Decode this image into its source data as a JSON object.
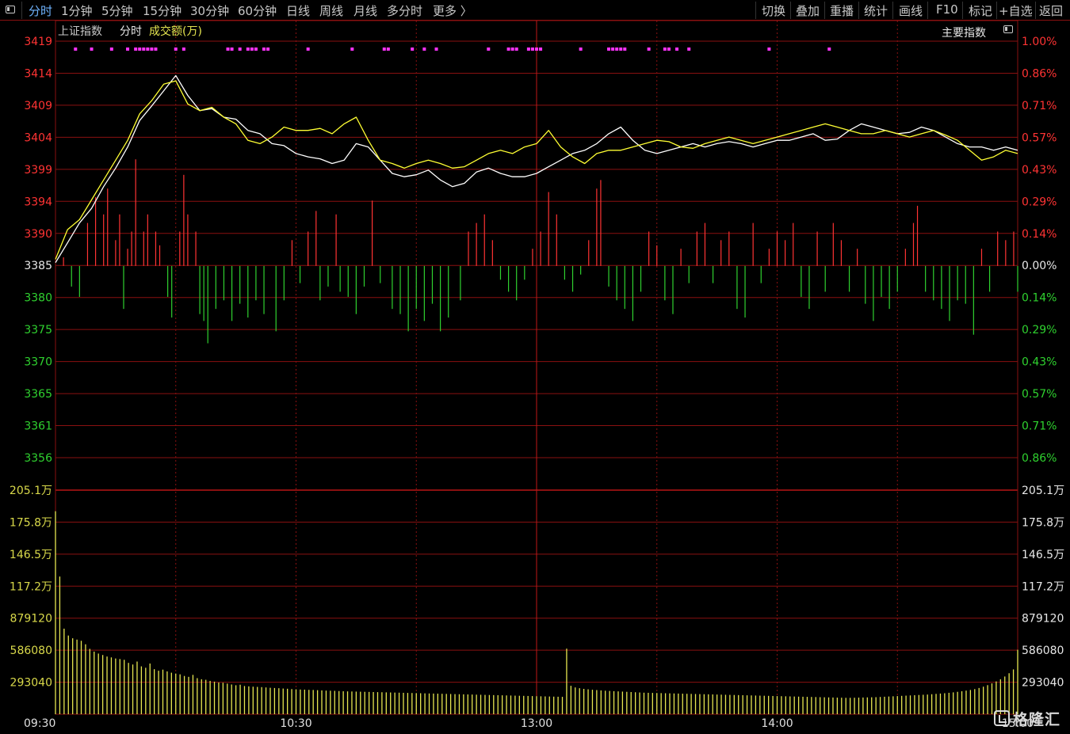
{
  "toolbar": {
    "left_tabs": [
      "分时",
      "1分钟",
      "5分钟",
      "15分钟",
      "30分钟",
      "60分钟",
      "日线",
      "周线",
      "月线",
      "多分时",
      "更多 〉"
    ],
    "right_tabs": [
      "切换",
      "叠加",
      "重播",
      "统计",
      "画线",
      "F10",
      "标记",
      "+自选",
      "返回"
    ],
    "active_tab": "分时"
  },
  "header": {
    "index_name": "上证指数",
    "mode": "分时",
    "volume_label": "成交额(万)",
    "main_index_label": "主要指数"
  },
  "colors": {
    "up": "#ff3333",
    "down": "#2fd12f",
    "grid": "#8a1010",
    "price_line": "#ffffff",
    "avg_line": "#ffff33",
    "volume_bar": "#e6e650",
    "marker": "#ff33ff",
    "volume_axis_text": "#d9d94a"
  },
  "chart_data": {
    "type": "line",
    "price_axis": {
      "left_ticks": [
        "3419",
        "3414",
        "3409",
        "3404",
        "3399",
        "3394",
        "3390",
        "3385",
        "3380",
        "3375",
        "3370",
        "3365",
        "3361",
        "3356"
      ],
      "right_ticks": [
        "1.00%",
        "0.86%",
        "0.71%",
        "0.57%",
        "0.43%",
        "0.29%",
        "0.14%",
        "0.00%",
        "0.14%",
        "0.29%",
        "0.43%",
        "0.57%",
        "0.71%",
        "0.86%"
      ],
      "ylim": [
        3356,
        3419
      ],
      "baseline": 3385
    },
    "volume_axis": {
      "ticks": [
        "205.1万",
        "175.8万",
        "146.5万",
        "117.2万",
        "879120",
        "586080",
        "293040"
      ],
      "ylim": [
        0,
        2051000
      ]
    },
    "time_axis": {
      "ticks": [
        "09:30",
        "10:30",
        "13:00",
        "14:00",
        "15:00"
      ],
      "total_minutes": 240
    },
    "series": [
      {
        "name": "白线",
        "x": [
          0,
          3,
          6,
          9,
          12,
          15,
          18,
          21,
          24,
          27,
          30,
          33,
          36,
          39,
          42,
          45,
          48,
          51,
          54,
          57,
          60,
          63,
          66,
          69,
          72,
          75,
          78,
          81,
          84,
          87,
          90,
          93,
          96,
          99,
          102,
          105,
          108,
          111,
          114,
          117,
          120,
          123,
          126,
          129,
          132,
          135,
          138,
          141,
          144,
          147,
          150,
          153,
          156,
          159,
          162,
          165,
          168,
          171,
          174,
          177,
          180,
          183,
          186,
          189,
          192,
          195,
          198,
          201,
          204,
          207,
          210,
          213,
          216,
          219,
          222,
          225,
          228,
          231,
          234,
          237,
          240
        ],
        "values": [
          3385.5,
          3388.5,
          3391.5,
          3393.7,
          3397.0,
          3399.8,
          3403.0,
          3407.0,
          3409.2,
          3411.5,
          3413.8,
          3410.8,
          3408.5,
          3408.8,
          3407.5,
          3407.2,
          3405.5,
          3405.0,
          3403.5,
          3403.2,
          3402.0,
          3401.5,
          3401.2,
          3400.5,
          3401.0,
          3403.5,
          3403.0,
          3401.0,
          3399.0,
          3398.5,
          3398.8,
          3399.5,
          3398.0,
          3397.0,
          3397.5,
          3399.2,
          3399.8,
          3399.0,
          3398.5,
          3398.5,
          3399.0,
          3400.0,
          3401.0,
          3402.0,
          3402.5,
          3403.5,
          3405.0,
          3406.0,
          3404.0,
          3402.5,
          3402.0,
          3402.5,
          3403.0,
          3403.5,
          3403.0,
          3403.5,
          3403.8,
          3403.5,
          3403.0,
          3403.5,
          3404.0,
          3404.0,
          3404.5,
          3405.0,
          3404.0,
          3404.2,
          3405.5,
          3406.5,
          3406.0,
          3405.5,
          3405.0,
          3405.2,
          3406.0,
          3405.5,
          3404.5,
          3403.5,
          3403.0,
          3403.0,
          3402.5,
          3403.0,
          3402.5
        ]
      },
      {
        "name": "黄线",
        "x": [
          0,
          3,
          6,
          9,
          12,
          15,
          18,
          21,
          24,
          27,
          30,
          33,
          36,
          39,
          42,
          45,
          48,
          51,
          54,
          57,
          60,
          63,
          66,
          69,
          72,
          75,
          78,
          81,
          84,
          87,
          90,
          93,
          96,
          99,
          102,
          105,
          108,
          111,
          114,
          117,
          120,
          123,
          126,
          129,
          132,
          135,
          138,
          141,
          144,
          147,
          150,
          153,
          156,
          159,
          162,
          165,
          168,
          171,
          174,
          177,
          180,
          183,
          186,
          189,
          192,
          195,
          198,
          201,
          204,
          207,
          210,
          213,
          216,
          219,
          222,
          225,
          228,
          231,
          234,
          237,
          240
        ],
        "values": [
          3386.0,
          3390.5,
          3392.0,
          3395.0,
          3398.0,
          3401.0,
          3404.0,
          3408.0,
          3410.0,
          3412.5,
          3413.0,
          3409.5,
          3408.5,
          3409.0,
          3407.5,
          3406.5,
          3404.0,
          3403.5,
          3404.5,
          3406.0,
          3405.5,
          3405.5,
          3405.8,
          3405.0,
          3406.5,
          3407.5,
          3404.0,
          3401.0,
          3400.5,
          3399.8,
          3400.5,
          3401.0,
          3400.5,
          3399.8,
          3400.0,
          3401.0,
          3402.0,
          3402.5,
          3402.0,
          3403.0,
          3403.5,
          3405.5,
          3403.0,
          3401.5,
          3400.5,
          3402.0,
          3402.5,
          3402.5,
          3403.0,
          3403.5,
          3404.0,
          3403.8,
          3403.0,
          3402.8,
          3403.5,
          3404.0,
          3404.5,
          3404.0,
          3403.5,
          3404.0,
          3404.5,
          3405.0,
          3405.5,
          3406.0,
          3406.5,
          3406.0,
          3405.5,
          3405.0,
          3405.0,
          3405.5,
          3405.0,
          3404.5,
          3405.0,
          3405.5,
          3404.8,
          3404.0,
          3402.5,
          3401.0,
          3401.5,
          3402.5,
          3402.0
        ]
      }
    ],
    "diff_bars": [
      {
        "x": 2,
        "v": 0.5
      },
      {
        "x": 4,
        "v": -1.2
      },
      {
        "x": 6,
        "v": -1.8
      },
      {
        "x": 8,
        "v": 2.5
      },
      {
        "x": 10,
        "v": 4.0
      },
      {
        "x": 12,
        "v": 3.0
      },
      {
        "x": 13,
        "v": 4.5
      },
      {
        "x": 15,
        "v": 1.5
      },
      {
        "x": 16,
        "v": 3.0
      },
      {
        "x": 17,
        "v": -2.5
      },
      {
        "x": 18,
        "v": 1.0
      },
      {
        "x": 19,
        "v": 2.0
      },
      {
        "x": 20,
        "v": 6.2
      },
      {
        "x": 22,
        "v": 2.0
      },
      {
        "x": 23,
        "v": 3.0
      },
      {
        "x": 25,
        "v": 2.0
      },
      {
        "x": 26,
        "v": 1.2
      },
      {
        "x": 28,
        "v": -1.8
      },
      {
        "x": 29,
        "v": -3.0
      },
      {
        "x": 31,
        "v": 2.0
      },
      {
        "x": 32,
        "v": 5.3
      },
      {
        "x": 33,
        "v": 3.0
      },
      {
        "x": 35,
        "v": 2.0
      },
      {
        "x": 36,
        "v": -2.8
      },
      {
        "x": 37,
        "v": -3.2
      },
      {
        "x": 38,
        "v": -4.5
      },
      {
        "x": 40,
        "v": -2.5
      },
      {
        "x": 42,
        "v": -2.0
      },
      {
        "x": 44,
        "v": -3.2
      },
      {
        "x": 46,
        "v": -2.2
      },
      {
        "x": 48,
        "v": -3.0
      },
      {
        "x": 50,
        "v": -2.0
      },
      {
        "x": 52,
        "v": -2.8
      },
      {
        "x": 55,
        "v": -3.8
      },
      {
        "x": 57,
        "v": -2.0
      },
      {
        "x": 59,
        "v": 1.5
      },
      {
        "x": 61,
        "v": -1.0
      },
      {
        "x": 63,
        "v": 2.0
      },
      {
        "x": 65,
        "v": 3.2
      },
      {
        "x": 66,
        "v": -2.0
      },
      {
        "x": 68,
        "v": -1.2
      },
      {
        "x": 70,
        "v": 3.0
      },
      {
        "x": 71,
        "v": -1.5
      },
      {
        "x": 73,
        "v": -1.8
      },
      {
        "x": 75,
        "v": -2.8
      },
      {
        "x": 77,
        "v": -1.2
      },
      {
        "x": 79,
        "v": 3.8
      },
      {
        "x": 81,
        "v": -1.0
      },
      {
        "x": 84,
        "v": -2.5
      },
      {
        "x": 86,
        "v": -2.8
      },
      {
        "x": 88,
        "v": -3.8
      },
      {
        "x": 90,
        "v": -2.5
      },
      {
        "x": 92,
        "v": -3.2
      },
      {
        "x": 94,
        "v": -2.2
      },
      {
        "x": 96,
        "v": -3.8
      },
      {
        "x": 98,
        "v": -3.0
      },
      {
        "x": 101,
        "v": -2.0
      },
      {
        "x": 103,
        "v": 2.0
      },
      {
        "x": 105,
        "v": 2.5
      },
      {
        "x": 107,
        "v": 3.0
      },
      {
        "x": 109,
        "v": 1.5
      },
      {
        "x": 111,
        "v": -0.8
      },
      {
        "x": 113,
        "v": -1.5
      },
      {
        "x": 115,
        "v": -2.0
      },
      {
        "x": 117,
        "v": -0.8
      },
      {
        "x": 119,
        "v": 1.0
      },
      {
        "x": 121,
        "v": 2.0
      },
      {
        "x": 123,
        "v": 4.3
      },
      {
        "x": 125,
        "v": 3.0
      },
      {
        "x": 127,
        "v": -0.8
      },
      {
        "x": 129,
        "v": -1.5
      },
      {
        "x": 131,
        "v": -0.5
      },
      {
        "x": 133,
        "v": 1.5
      },
      {
        "x": 135,
        "v": 4.5
      },
      {
        "x": 136,
        "v": 5.0
      },
      {
        "x": 138,
        "v": -1.2
      },
      {
        "x": 140,
        "v": -2.0
      },
      {
        "x": 142,
        "v": -2.5
      },
      {
        "x": 144,
        "v": -3.2
      },
      {
        "x": 146,
        "v": -1.5
      },
      {
        "x": 148,
        "v": 2.0
      },
      {
        "x": 150,
        "v": 1.2
      },
      {
        "x": 152,
        "v": -2.0
      },
      {
        "x": 154,
        "v": -2.8
      },
      {
        "x": 156,
        "v": 1.0
      },
      {
        "x": 158,
        "v": -1.0
      },
      {
        "x": 160,
        "v": 2.0
      },
      {
        "x": 162,
        "v": 2.5
      },
      {
        "x": 164,
        "v": -1.0
      },
      {
        "x": 166,
        "v": 1.5
      },
      {
        "x": 168,
        "v": 2.0
      },
      {
        "x": 170,
        "v": -2.5
      },
      {
        "x": 172,
        "v": -3.0
      },
      {
        "x": 174,
        "v": 2.5
      },
      {
        "x": 176,
        "v": -1.0
      },
      {
        "x": 178,
        "v": 1.0
      },
      {
        "x": 180,
        "v": 2.0
      },
      {
        "x": 182,
        "v": 1.5
      },
      {
        "x": 184,
        "v": 2.5
      },
      {
        "x": 186,
        "v": -1.8
      },
      {
        "x": 188,
        "v": -2.5
      },
      {
        "x": 190,
        "v": 2.0
      },
      {
        "x": 192,
        "v": -1.5
      },
      {
        "x": 194,
        "v": 2.5
      },
      {
        "x": 196,
        "v": 1.5
      },
      {
        "x": 198,
        "v": -1.5
      },
      {
        "x": 200,
        "v": 1.0
      },
      {
        "x": 202,
        "v": -2.2
      },
      {
        "x": 204,
        "v": -3.2
      },
      {
        "x": 206,
        "v": -1.8
      },
      {
        "x": 208,
        "v": -2.5
      },
      {
        "x": 210,
        "v": -1.5
      },
      {
        "x": 212,
        "v": 1.0
      },
      {
        "x": 214,
        "v": 2.5
      },
      {
        "x": 215,
        "v": 3.5
      },
      {
        "x": 217,
        "v": -1.5
      },
      {
        "x": 219,
        "v": -2.0
      },
      {
        "x": 221,
        "v": -2.5
      },
      {
        "x": 223,
        "v": -3.2
      },
      {
        "x": 225,
        "v": -2.0
      },
      {
        "x": 227,
        "v": -2.2
      },
      {
        "x": 229,
        "v": -4.0
      },
      {
        "x": 231,
        "v": 1.0
      },
      {
        "x": 233,
        "v": -1.5
      },
      {
        "x": 235,
        "v": 2.0
      },
      {
        "x": 237,
        "v": 1.5
      },
      {
        "x": 239,
        "v": 2.0
      },
      {
        "x": 240,
        "v": -1.5
      }
    ],
    "volume": [
      1858000,
      1260000,
      783000,
      720000,
      695000,
      683000,
      672000,
      640000,
      598000,
      573000,
      555000,
      542000,
      528000,
      520000,
      510000,
      505000,
      498000,
      470000,
      455000,
      482000,
      438000,
      425000,
      464000,
      412000,
      398000,
      408000,
      392000,
      380000,
      372000,
      365000,
      350000,
      342000,
      360000,
      330000,
      320000,
      315000,
      305000,
      298000,
      290000,
      288000,
      280000,
      272000,
      265000,
      270000,
      258000,
      255000,
      252000,
      250000,
      248000,
      245000,
      242000,
      240000,
      238000,
      235000,
      233000,
      230000,
      228000,
      226000,
      225000,
      223000,
      222000,
      220000,
      218000,
      216000,
      215000,
      214000,
      212000,
      210000,
      209000,
      208000,
      207000,
      206000,
      205000,
      204000,
      203000,
      202000,
      201000,
      200000,
      199000,
      198000,
      197000,
      196000,
      195000,
      194000,
      193000,
      192000,
      191000,
      190000,
      189000,
      188000,
      187000,
      186000,
      185000,
      184000,
      183000,
      182000,
      181000,
      180000,
      179000,
      178000,
      177000,
      176000,
      175000,
      174000,
      173000,
      172000,
      171000,
      170000,
      169000,
      168000,
      167000,
      166000,
      165000,
      164000,
      163000,
      162000,
      161000,
      160000,
      159000,
      600000,
      260000,
      245000,
      238000,
      232000,
      228000,
      224000,
      221000,
      218000,
      215000,
      213000,
      211000,
      209000,
      207000,
      205000,
      203000,
      201000,
      199000,
      197000,
      196000,
      195000,
      194000,
      193000,
      192000,
      191000,
      190000,
      189000,
      188000,
      187000,
      186000,
      185000,
      184000,
      183000,
      182000,
      181000,
      180000,
      179000,
      178000,
      177000,
      176000,
      175000,
      174000,
      173000,
      172000,
      171000,
      170000,
      169000,
      168000,
      167000,
      166000,
      165000,
      164000,
      163000,
      162000,
      161000,
      160000,
      159000,
      158000,
      157000,
      156000,
      155000,
      154000,
      153000,
      152000,
      151000,
      150000,
      150000,
      151000,
      152000,
      153000,
      154000,
      155000,
      156000,
      158000,
      160000,
      162000,
      164000,
      166000,
      168000,
      170000,
      172000,
      174000,
      176000,
      178000,
      180000,
      183000,
      186000,
      189000,
      192000,
      196000,
      200000,
      205000,
      210000,
      216000,
      222000,
      230000,
      240000,
      252000,
      266000,
      282000,
      300000,
      320000,
      345000,
      375000,
      410000,
      590000
    ],
    "markers": [
      5,
      9,
      14,
      18,
      20,
      21,
      22,
      23,
      24,
      25,
      30,
      32,
      43,
      44,
      46,
      48,
      49,
      50,
      52,
      53,
      63,
      74,
      82,
      83,
      89,
      92,
      95,
      108,
      113,
      114,
      115,
      118,
      119,
      120,
      121,
      131,
      138,
      139,
      140,
      141,
      142,
      148,
      152,
      153,
      155,
      158,
      178,
      193
    ]
  }
}
